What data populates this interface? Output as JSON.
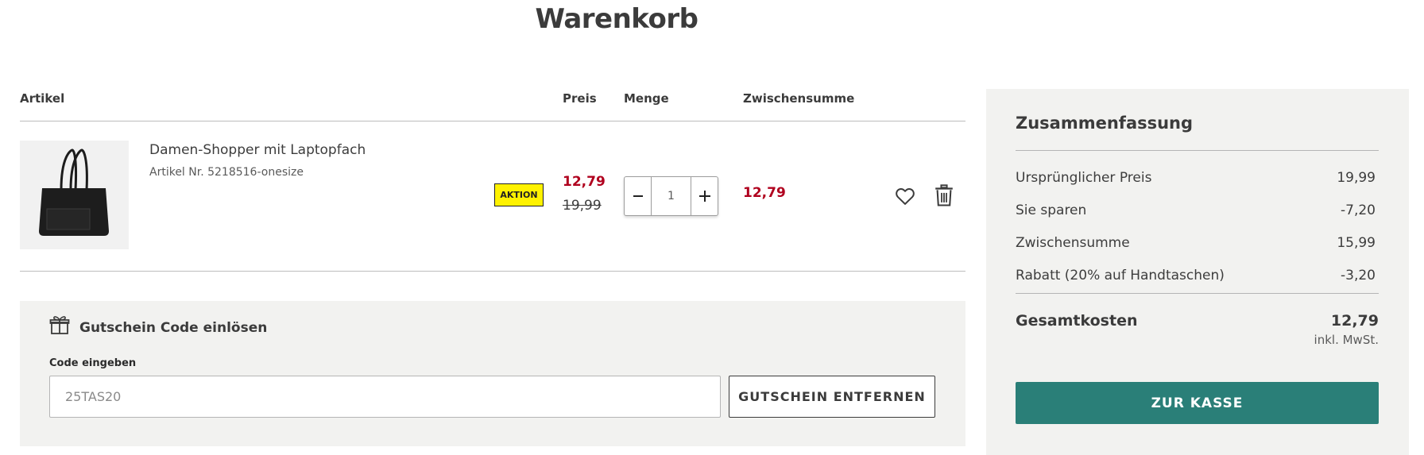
{
  "page": {
    "title": "Warenkorb"
  },
  "cart": {
    "headers": {
      "artikel": "Artikel",
      "preis": "Preis",
      "menge": "Menge",
      "zwischensumme": "Zwischensumme"
    },
    "items": [
      {
        "name": "Damen-Shopper mit Laptopfach",
        "sku": "Artikel Nr. 5218516-onesize",
        "badge": "AKTION",
        "price_now": "12,79",
        "price_old": "19,99",
        "quantity": "1",
        "subtotal": "12,79",
        "image_icon": "tote-bag-image"
      }
    ]
  },
  "voucher": {
    "title": "Gutschein Code einlösen",
    "label": "Code eingeben",
    "value": "25TAS20",
    "button": "GUTSCHEIN ENTFERNEN"
  },
  "summary": {
    "title": "Zusammenfassung",
    "rows": [
      {
        "label": "Ursprünglicher Preis",
        "value": "19,99"
      },
      {
        "label": "Sie sparen",
        "value": "-7,20"
      },
      {
        "label": "Zwischensumme",
        "value": "15,99"
      },
      {
        "label": "Rabatt (20% auf Handtaschen)",
        "value": "-3,20"
      }
    ],
    "total_label": "Gesamtkosten",
    "total_value": "12,79",
    "vat_note": "inkl. MwSt.",
    "checkout_button": "ZUR KASSE"
  },
  "colors": {
    "sale_red": "#b0001e",
    "badge_yellow": "#fff200",
    "checkout_teal": "#2a7f78",
    "panel_bg": "#f2f2f0"
  }
}
